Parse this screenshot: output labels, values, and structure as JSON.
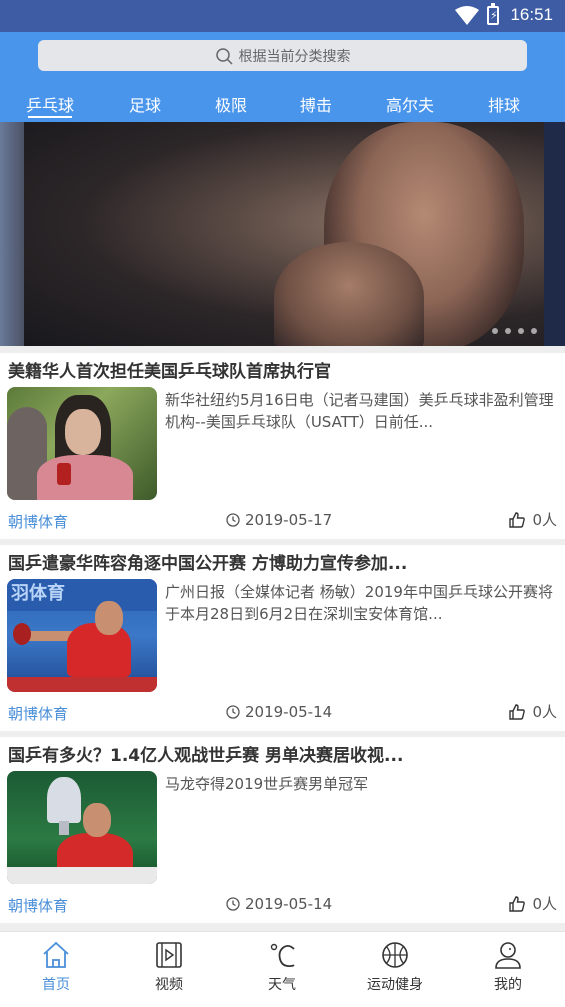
{
  "status": {
    "time": "16:51"
  },
  "search": {
    "placeholder": "根据当前分类搜索"
  },
  "tabs": [
    {
      "label": "乒乓球",
      "active": true
    },
    {
      "label": "足球"
    },
    {
      "label": "极限"
    },
    {
      "label": "搏击"
    },
    {
      "label": "高尔夫"
    },
    {
      "label": "排球"
    }
  ],
  "banner": {
    "page_count": 4
  },
  "news": [
    {
      "title": "美籍华人首次担任美国乒乓球队首席执行官",
      "summary": "新华社纽约5月16日电（记者马建国）美乒乓球非盈利管理机构--美国乒乓球队（USATT）日前任...",
      "source": "朝博体育",
      "date": "2019-05-17",
      "likes": "0人"
    },
    {
      "title": "国乒遣豪华阵容角逐中国公开赛 方博助力宣传参加...",
      "summary": "广州日报（全媒体记者 杨敏）2019年中国乒乓球公开赛将于本月28日到6月2日在深圳宝安体育馆...",
      "source": "朝博体育",
      "date": "2019-05-14",
      "likes": "0人",
      "thumb_text": "羽体育"
    },
    {
      "title": "国乒有多火？1.4亿人观战世乒赛 男单决赛居收视...",
      "summary": "马龙夺得2019世乒赛男单冠军",
      "source": "朝博体育",
      "date": "2019-05-14",
      "likes": "0人"
    }
  ],
  "bottom_nav": [
    {
      "label": "首页",
      "icon": "home-icon",
      "active": true
    },
    {
      "label": "视频",
      "icon": "video-icon"
    },
    {
      "label": "天气",
      "icon": "weather-icon"
    },
    {
      "label": "运动健身",
      "icon": "basketball-icon"
    },
    {
      "label": "我的",
      "icon": "user-icon"
    }
  ],
  "colors": {
    "header": "#4a95ec",
    "statusbar": "#3d5ca3",
    "accent": "#4a8fd8"
  }
}
